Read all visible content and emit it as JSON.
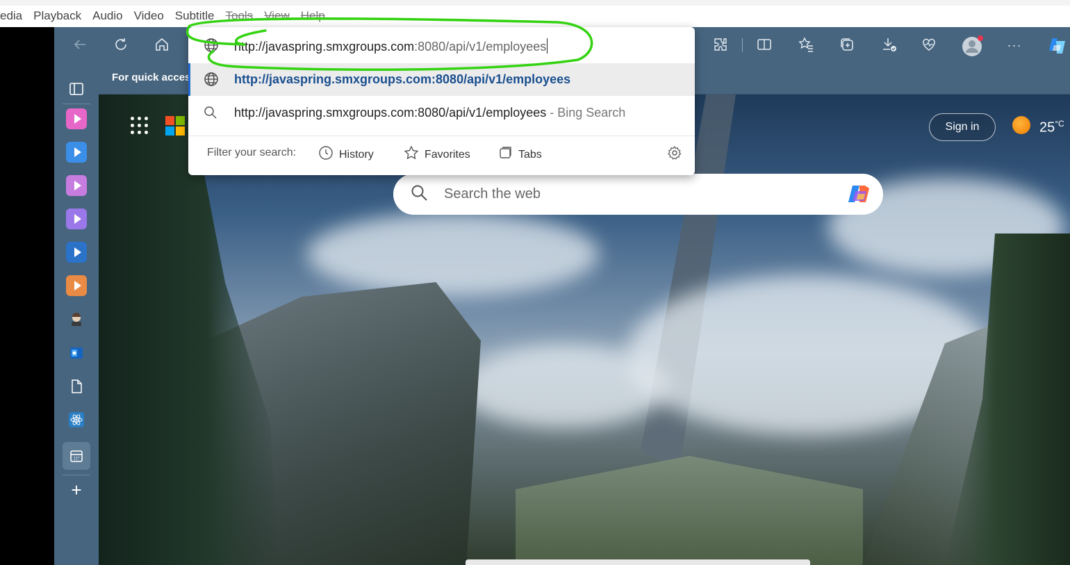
{
  "app_menu": {
    "items": [
      "edia",
      "Playback",
      "Audio",
      "Video",
      "Subtitle",
      "Tools",
      "View",
      "Help"
    ]
  },
  "toolbar": {
    "back_icon": "back-arrow-icon",
    "refresh_icon": "refresh-icon",
    "home_icon": "home-icon",
    "right_icons": [
      "extensions-icon",
      "split-screen-icon",
      "favorites-icon",
      "collections-icon",
      "downloads-icon",
      "browser-essentials-icon",
      "profile-icon",
      "more-icon",
      "copilot-icon"
    ],
    "more_label": "···"
  },
  "favorites_bar": {
    "text": "For quick acces"
  },
  "address_bar": {
    "value_main": "http://javaspring.smxgroups.com",
    "value_dim": ":8080/api/v1/employees"
  },
  "suggestions": {
    "selected": "http://javaspring.smxgroups.com:8080/api/v1/employees",
    "bing_query": "http://javaspring.smxgroups.com:8080/api/v1/employees",
    "bing_suffix": " - Bing Search"
  },
  "filter": {
    "label": "Filter your search:",
    "chips": [
      {
        "label": "History",
        "icon": "history-icon"
      },
      {
        "label": "Favorites",
        "icon": "star-icon"
      },
      {
        "label": "Tabs",
        "icon": "tabs-icon"
      }
    ]
  },
  "new_tab_page": {
    "sign_in": "Sign in",
    "weather_temp": "25",
    "weather_unit": "°C",
    "search_placeholder": "Search the web"
  },
  "sidebar": {
    "tiles": [
      {
        "name": "sidebar-app-pink",
        "color": "#e667c8"
      },
      {
        "name": "sidebar-app-blue",
        "color": "#3b8fe8"
      },
      {
        "name": "sidebar-app-violet",
        "color": "#c77ce0"
      },
      {
        "name": "sidebar-app-purple",
        "color": "#9a78ea"
      },
      {
        "name": "sidebar-app-darkblue",
        "color": "#2a73c9"
      },
      {
        "name": "sidebar-app-orange",
        "color": "#e98a45"
      }
    ],
    "add_label": "+"
  },
  "colors": {
    "toolbar_bg": "#47657f",
    "annotation": "#34d312",
    "selected_link": "#1a4f8f"
  }
}
